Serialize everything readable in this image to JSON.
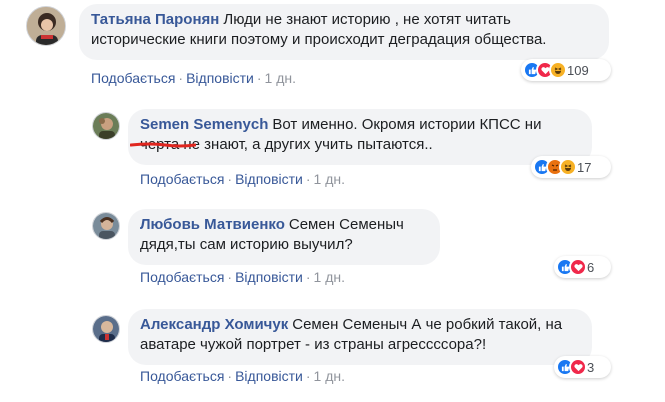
{
  "colors": {
    "link": "#385898",
    "bubble": "#f2f3f5",
    "like": "#1877f2",
    "love": "#f0284a",
    "haha": "#f7b125",
    "angry": "#e9710f"
  },
  "actions": {
    "like": "Подобається",
    "reply": "Відповісти",
    "separator": "·"
  },
  "comments": [
    {
      "author": "Татьяна Паронян",
      "text": "Люди не знают историю , не хотят читать исторические книги поэтому и происходит деградация общества.",
      "time": "1 дн.",
      "reactions": [
        "like-icon",
        "love-icon",
        "haha-icon"
      ],
      "count": "109"
    },
    {
      "author": "Semen Semenych",
      "text": "Вот именно. Окромя истории КПСС ни черта не знают, а других учить пытаются..",
      "time": "1 дн.",
      "reactions": [
        "like-icon",
        "angry-icon",
        "haha-icon"
      ],
      "count": "17"
    },
    {
      "author": "Любовь Матвиенко",
      "text": "Семен Семеныч дядя,ты сам историю выучил?",
      "time": "1 дн.",
      "reactions": [
        "like-icon",
        "love-icon"
      ],
      "count": "6"
    },
    {
      "author": "Александр Хомичук",
      "text": "Семен Семеныч А че робкий такой, на аватаре чужой портрет - из страны агрессссора?!",
      "time": "1 дн.",
      "reactions": [
        "like-icon",
        "love-icon"
      ],
      "count": "3"
    }
  ]
}
